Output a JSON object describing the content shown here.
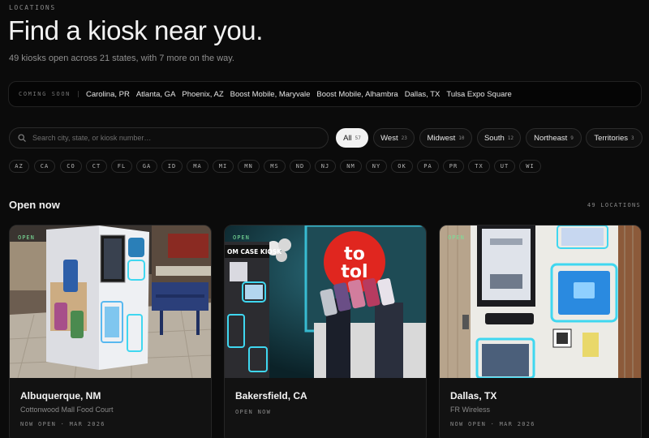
{
  "header": {
    "eyebrow": "LOCATIONS",
    "title": "Find a kiosk near you.",
    "subtitle": "49 kiosks open across 21 states, with 7 more on the way."
  },
  "coming_soon": {
    "label": "COMING SOON",
    "items": [
      "Carolina, PR",
      "Atlanta, GA",
      "Phoenix, AZ",
      "Boost Mobile, Maryvale",
      "Boost Mobile, Alhambra",
      "Dallas, TX",
      "Tulsa Expo Square"
    ]
  },
  "search": {
    "placeholder": "Search city, state, or kiosk number…"
  },
  "regions": [
    {
      "label": "All",
      "count": "57",
      "active": true
    },
    {
      "label": "West",
      "count": "23",
      "active": false
    },
    {
      "label": "Midwest",
      "count": "10",
      "active": false
    },
    {
      "label": "South",
      "count": "12",
      "active": false
    },
    {
      "label": "Northeast",
      "count": "9",
      "active": false
    },
    {
      "label": "Territories",
      "count": "3",
      "active": false
    }
  ],
  "states": [
    "AZ",
    "CA",
    "CO",
    "CT",
    "FL",
    "GA",
    "ID",
    "MA",
    "MI",
    "MN",
    "MS",
    "ND",
    "NJ",
    "NM",
    "NY",
    "OK",
    "PA",
    "PR",
    "TX",
    "UT",
    "WI"
  ],
  "open_now": {
    "title": "Open now",
    "count": "49 LOCATIONS"
  },
  "cards": [
    {
      "badge": "OPEN",
      "city": "Albuquerque, NM",
      "venue": "Cottonwood Mall Food Court",
      "status": "NOW OPEN · MAR 2026"
    },
    {
      "badge": "OPEN",
      "city": "Bakersfield, CA",
      "venue": "",
      "status": "OPEN NOW",
      "photo_text_a": "OM CASE KIOSK",
      "photo_text_b": "to",
      "photo_text_c": "tol"
    },
    {
      "badge": "OPEN",
      "city": "Dallas, TX",
      "venue": "FR Wireless",
      "status": "NOW OPEN · MAR 2026"
    }
  ],
  "colors": {
    "accent_open": "#7be09a",
    "active_chip": "#f2f2f2",
    "glow": "#3fd7f0",
    "logo_red": "#e0261f"
  }
}
